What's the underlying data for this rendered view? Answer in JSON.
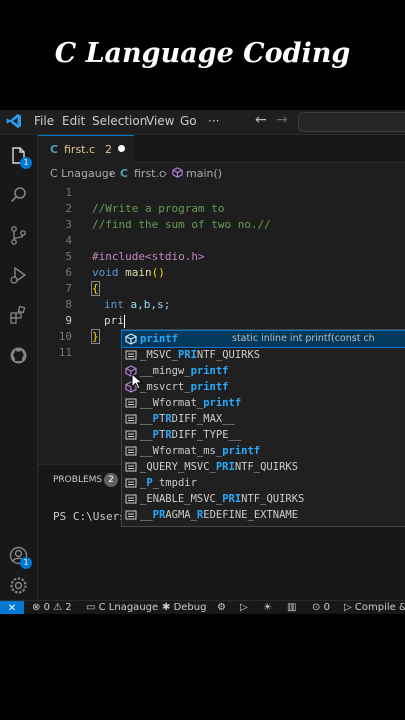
{
  "banner": {
    "title": "C Language Coding"
  },
  "titlebar": {
    "menus": [
      "File",
      "Edit",
      "Selection",
      "View",
      "Go",
      "···"
    ],
    "back": "←",
    "forward": "→"
  },
  "activity": {
    "explorer_badge": "1",
    "accounts_badge": "1"
  },
  "tab": {
    "icon": "C",
    "name": "first.c",
    "problems": "2"
  },
  "breadcrumb": {
    "folder": "C Lnagauge",
    "file_icon": "C",
    "file": "first.c",
    "symbol": "main()"
  },
  "editor": {
    "line_numbers": [
      "1",
      "2",
      "3",
      "4",
      "5",
      "6",
      "7",
      "8",
      "9",
      "10",
      "11"
    ],
    "line2": "//Write a program to",
    "line3": "//find the sum of two no.//",
    "line5": "#include<stdio.h>",
    "line6_kw": "void",
    "line6_fn": "main",
    "line6_paren": "()",
    "line7": "{",
    "line8_kw": "int",
    "line8_rest": " a,b,s;",
    "line9": "pri",
    "line10": "}"
  },
  "panel": {
    "tab_label": "PROBLEMS",
    "problems_count": "2",
    "terminal": "PS C:\\Users\\"
  },
  "suggest": {
    "detail": "static inline int printf(const ch",
    "items": [
      {
        "pre": "",
        "match": "printf",
        "post": "",
        "kind": "method"
      },
      {
        "pre": "_MSVC_",
        "match": "PRI",
        "post": "NTF_QUIRKS",
        "kind": "text"
      },
      {
        "pre": "__mingw_",
        "match": "printf",
        "post": "",
        "kind": "method"
      },
      {
        "pre": "_msvcrt_",
        "match": "printf",
        "post": "",
        "kind": "method"
      },
      {
        "pre": "__Wformat_",
        "match": "printf",
        "post": "",
        "kind": "text"
      },
      {
        "pre": "__",
        "match": "P",
        "post": "T",
        "m2": "R",
        "post2": "DIFF_MAX__",
        "kind": "text"
      },
      {
        "pre": "__",
        "match": "P",
        "post": "T",
        "m2": "R",
        "post2": "DIFF_TYPE__",
        "kind": "text"
      },
      {
        "pre": "__Wformat_ms_",
        "match": "printf",
        "post": "",
        "kind": "text"
      },
      {
        "pre": "_QUERY_MSVC_",
        "match": "PRI",
        "post": "NTF_QUIRKS",
        "kind": "text"
      },
      {
        "pre": "_",
        "match": "P",
        "post": "_tmpdir",
        "kind": "text"
      },
      {
        "pre": "_ENABLE_MSVC_",
        "match": "PRI",
        "post": "NTF_QUIRKS",
        "kind": "text"
      },
      {
        "pre": "__",
        "match": "PR",
        "post": "AGMA_",
        "m2": "R",
        "post2": "EDEFINE_EXTNAME",
        "kind": "text"
      }
    ]
  },
  "status": {
    "remote": "✕",
    "errors": "0",
    "warnings": "2",
    "project": "C Lnagauge",
    "debug": "Debug",
    "ports": "0",
    "compile": "Compile &"
  },
  "colors": {
    "accent": "#0078d4",
    "match": "#2aaaff",
    "comment": "#6a9955",
    "keyword": "#569cd6"
  }
}
